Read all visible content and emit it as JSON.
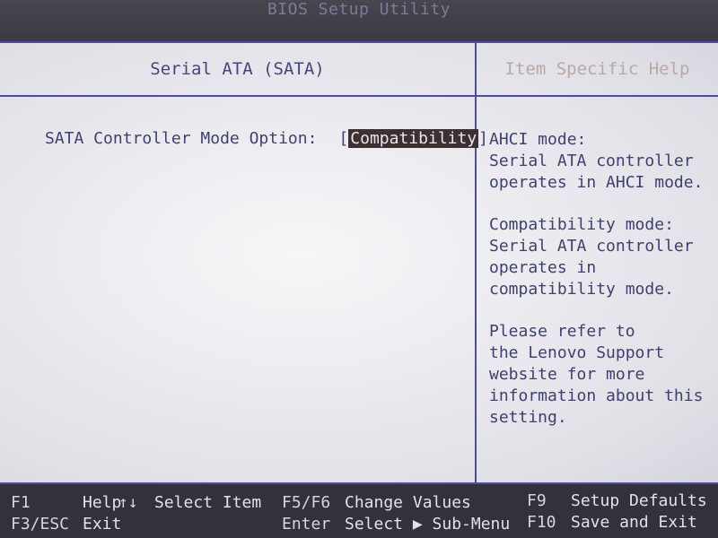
{
  "window": {
    "title": "BIOS Setup Utility"
  },
  "header": {
    "section_title": "Serial ATA (SATA)",
    "help_title": "Item Specific Help"
  },
  "option": {
    "label": "SATA Controller Mode Option:",
    "value": "Compatibility",
    "open_bracket": "[",
    "close_bracket": "]"
  },
  "help": {
    "paragraphs": [
      [
        "AHCI mode:",
        "Serial ATA controller",
        "operates in AHCI mode."
      ],
      [
        "Compatibility mode:",
        "Serial ATA controller",
        "operates in",
        "compatibility mode."
      ],
      [
        "Please refer to",
        "the Lenovo Support",
        "website for more",
        "information about this",
        "setting."
      ]
    ]
  },
  "footer": {
    "row1": {
      "k1": "F1",
      "d1": "Help",
      "k2": "↑↓",
      "d2": "Select Item",
      "k3": "F5/F6",
      "d3": "Change Values",
      "k4": "F9",
      "d4": "Setup Defaults"
    },
    "row2": {
      "k1": "F3/ESC",
      "d1": "Exit",
      "k2": "Enter",
      "d2": "Select ▶ Sub-Menu",
      "k4": "F10",
      "d4": "Save and Exit"
    }
  }
}
